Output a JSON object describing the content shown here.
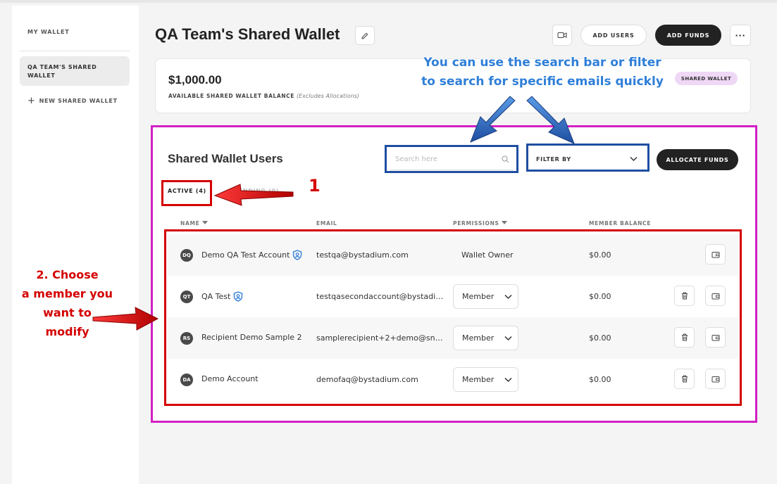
{
  "sidebar": {
    "heading": "MY WALLET",
    "active_item": "QA TEAM'S SHARED WALLET",
    "new_item": "NEW SHARED WALLET"
  },
  "header": {
    "title": "QA Team's Shared Wallet",
    "add_users": "ADD USERS",
    "add_funds": "ADD FUNDS",
    "more": "···"
  },
  "balance": {
    "amount": "$1,000.00",
    "label": "AVAILABLE SHARED WALLET BALANCE",
    "note": "(Excludes Allocations)",
    "badge": "SHARED WALLET"
  },
  "users": {
    "title": "Shared Wallet Users",
    "search_placeholder": "Search here",
    "filter_label": "FILTER BY",
    "allocate": "ALLOCATE FUNDS",
    "tabs": [
      {
        "label": "ACTIVE   (4)"
      },
      {
        "label": "PENDING   (0)"
      }
    ],
    "columns": {
      "name": "NAME",
      "email": "EMAIL",
      "permissions": "PERMISSIONS",
      "balance": "MEMBER BALANCE"
    },
    "rows": [
      {
        "initials": "DQ",
        "name": "Demo QA Test Account",
        "email": "testqa@bystadium.com",
        "permission": "Wallet Owner",
        "balance": "$0.00"
      },
      {
        "initials": "QT",
        "name": "QA Test",
        "email": "testqasecondaccount@bystadi…",
        "permission": "Member",
        "balance": "$0.00"
      },
      {
        "initials": "RS",
        "name": "Recipient Demo Sample 2",
        "email": "samplerecipient+2+demo@sn…",
        "permission": "Member",
        "balance": "$0.00"
      },
      {
        "initials": "DA",
        "name": "Demo Account",
        "email": "demofaq@bystadium.com",
        "permission": "Member",
        "balance": "$0.00"
      }
    ]
  },
  "annotations": {
    "search_tip_line1": "You can use the search bar or filter",
    "search_tip_line2": "to search for specific emails quickly",
    "step1": "1",
    "step2_line1": "2. Choose",
    "step2_line2": "a member you",
    "step2_line3": "want to",
    "step2_line4": "modify"
  },
  "colors": {
    "accent_dark": "#222222",
    "badge_bg": "#efd8f5",
    "verified_icon": "#2f7fd8",
    "annotation_red": "#d40000",
    "annotation_blue": "#1f4ea1",
    "annotation_magenta": "#d21fc4"
  }
}
